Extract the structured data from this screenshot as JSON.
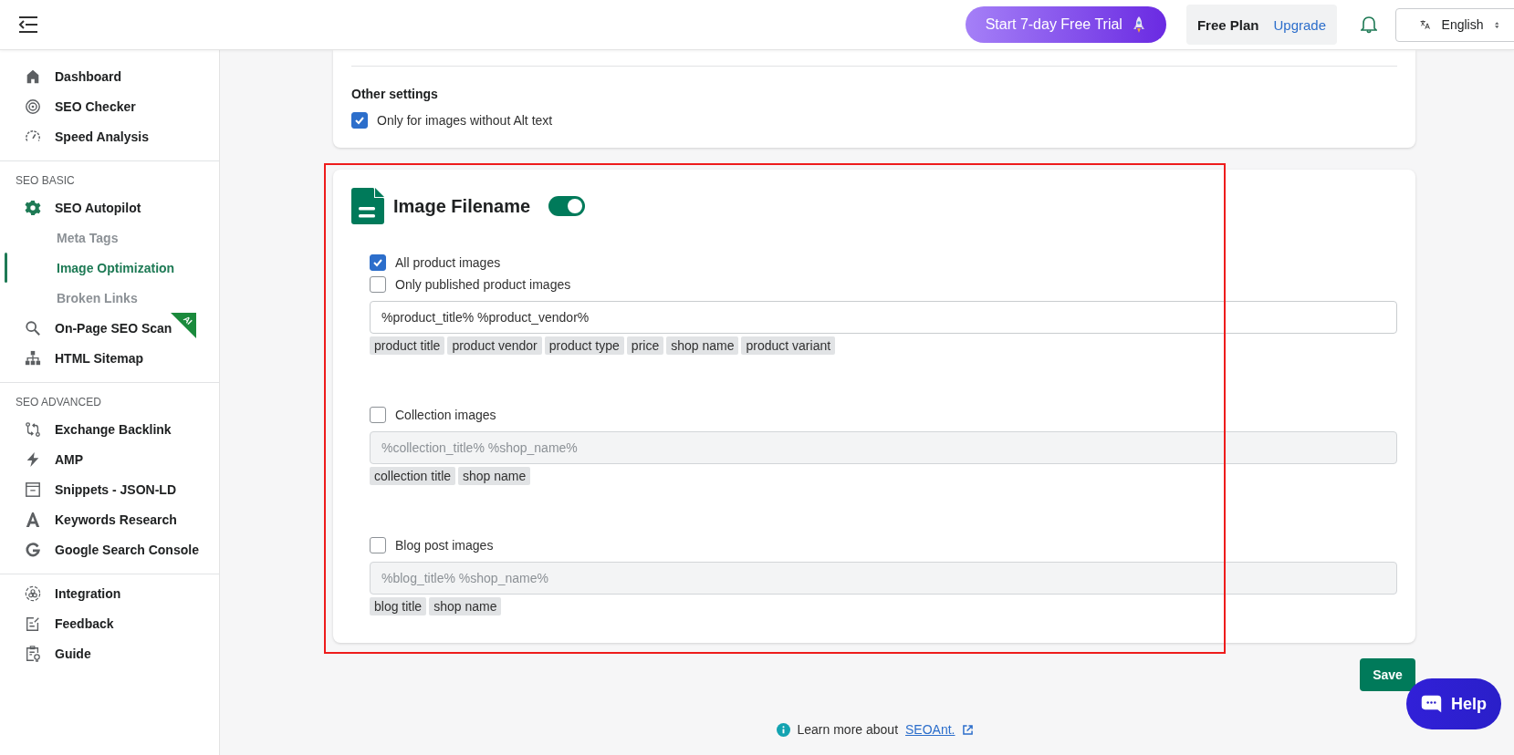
{
  "topbar": {
    "trial_button": "Start 7-day Free Trial",
    "plan": {
      "label": "Free Plan",
      "link": "Upgrade"
    },
    "language": "English"
  },
  "sidebar": {
    "sections": [
      {
        "items": [
          {
            "label": "Dashboard",
            "selected": false
          },
          {
            "label": "SEO Checker",
            "selected": false
          },
          {
            "label": "Speed Analysis",
            "selected": false
          }
        ]
      },
      {
        "heading": "SEO BASIC",
        "items": [
          {
            "label": "SEO Autopilot",
            "selected": false,
            "children": [
              {
                "label": "Meta Tags",
                "selected": false
              },
              {
                "label": "Image Optimization",
                "selected": true
              },
              {
                "label": "Broken Links",
                "selected": false
              }
            ]
          },
          {
            "label": "On-Page SEO Scan",
            "selected": false,
            "badge": "AI"
          },
          {
            "label": "HTML Sitemap",
            "selected": false
          }
        ]
      },
      {
        "heading": "SEO ADVANCED",
        "items": [
          {
            "label": "Exchange Backlink",
            "selected": false
          },
          {
            "label": "AMP",
            "selected": false
          },
          {
            "label": "Snippets - JSON-LD",
            "selected": false
          },
          {
            "label": "Keywords Research",
            "selected": false
          },
          {
            "label": "Google Search Console",
            "selected": false
          }
        ]
      },
      {
        "items": [
          {
            "label": "Integration",
            "selected": false
          },
          {
            "label": "Feedback",
            "selected": false
          },
          {
            "label": "Guide",
            "selected": false
          }
        ]
      }
    ]
  },
  "other_settings": {
    "heading": "Other settings",
    "options": [
      {
        "label": "Only for images without Alt text",
        "checked": true
      }
    ]
  },
  "image_filename": {
    "title": "Image Filename",
    "on": true,
    "groups": [
      {
        "options": [
          {
            "label": "All product images",
            "checked": true
          },
          {
            "label": "Only published product images",
            "checked": false
          }
        ],
        "field": {
          "value": "%product_title% %product_vendor%",
          "disabled": false
        },
        "tags": [
          "product title",
          "product vendor",
          "product type",
          "price",
          "shop name",
          "product variant"
        ]
      },
      {
        "options": [
          {
            "label": "Collection images",
            "checked": false
          }
        ],
        "field": {
          "placeholder": "%collection_title% %shop_name%",
          "disabled": true
        },
        "tags": [
          "collection title",
          "shop name"
        ]
      },
      {
        "options": [
          {
            "label": "Blog post images",
            "checked": false
          }
        ],
        "field": {
          "placeholder": "%blog_title% %shop_name%",
          "disabled": true
        },
        "tags": [
          "blog title",
          "shop name"
        ]
      }
    ]
  },
  "save_button": "Save",
  "footer": {
    "text": "Learn more about",
    "link": "SEOAnt."
  },
  "help_button": "Help"
}
